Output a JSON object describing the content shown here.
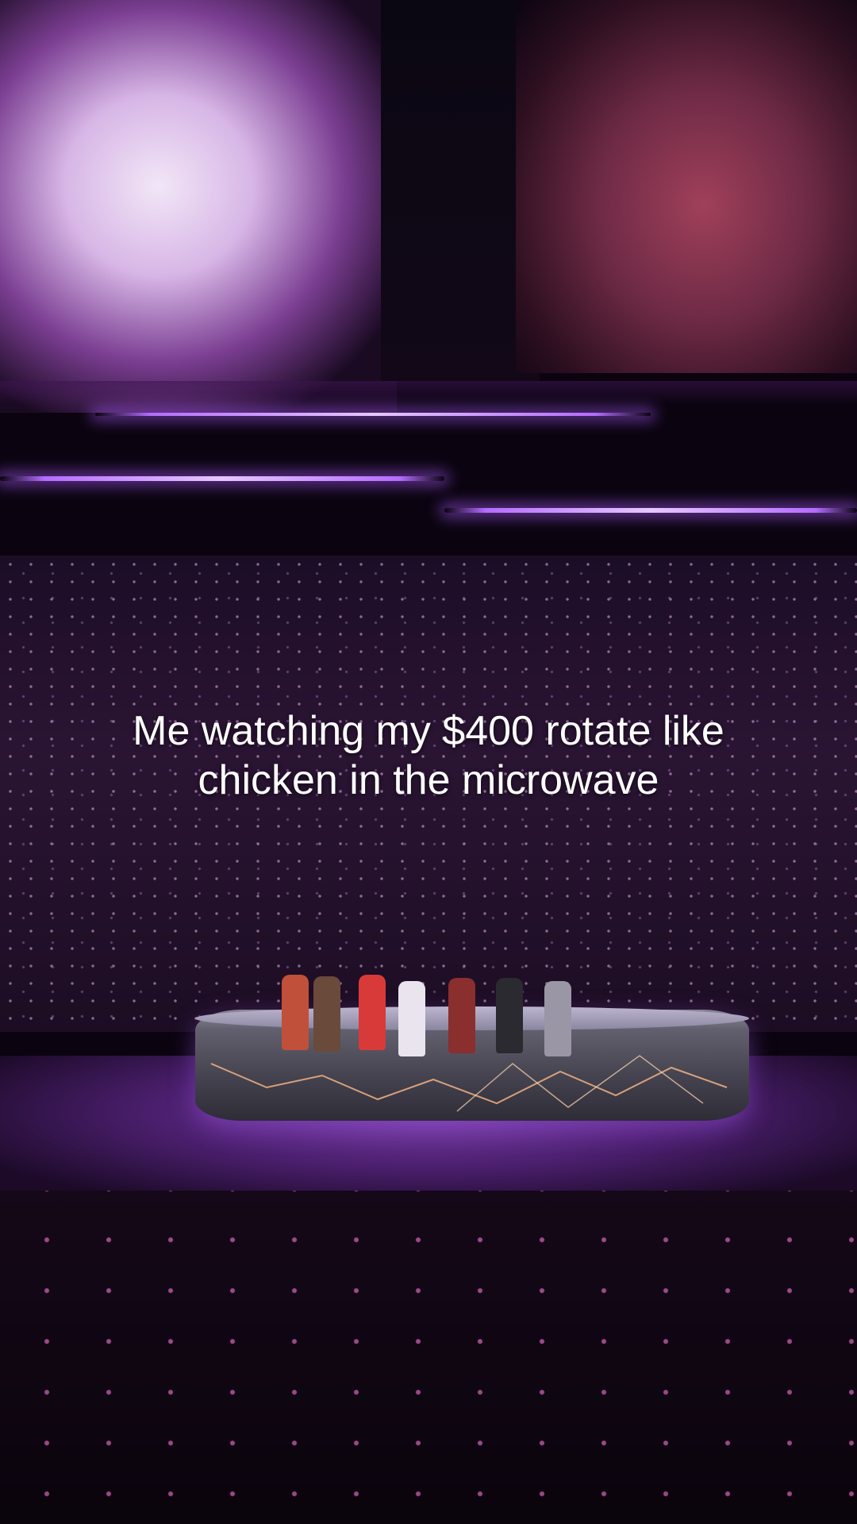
{
  "caption": {
    "line1": "Me watching my $400 rotate like",
    "line2": "chicken in the microwave"
  },
  "colors": {
    "accent_purple": "#b46cff",
    "lightstick_pink": "#ff78dc",
    "background": "#0b0410"
  }
}
